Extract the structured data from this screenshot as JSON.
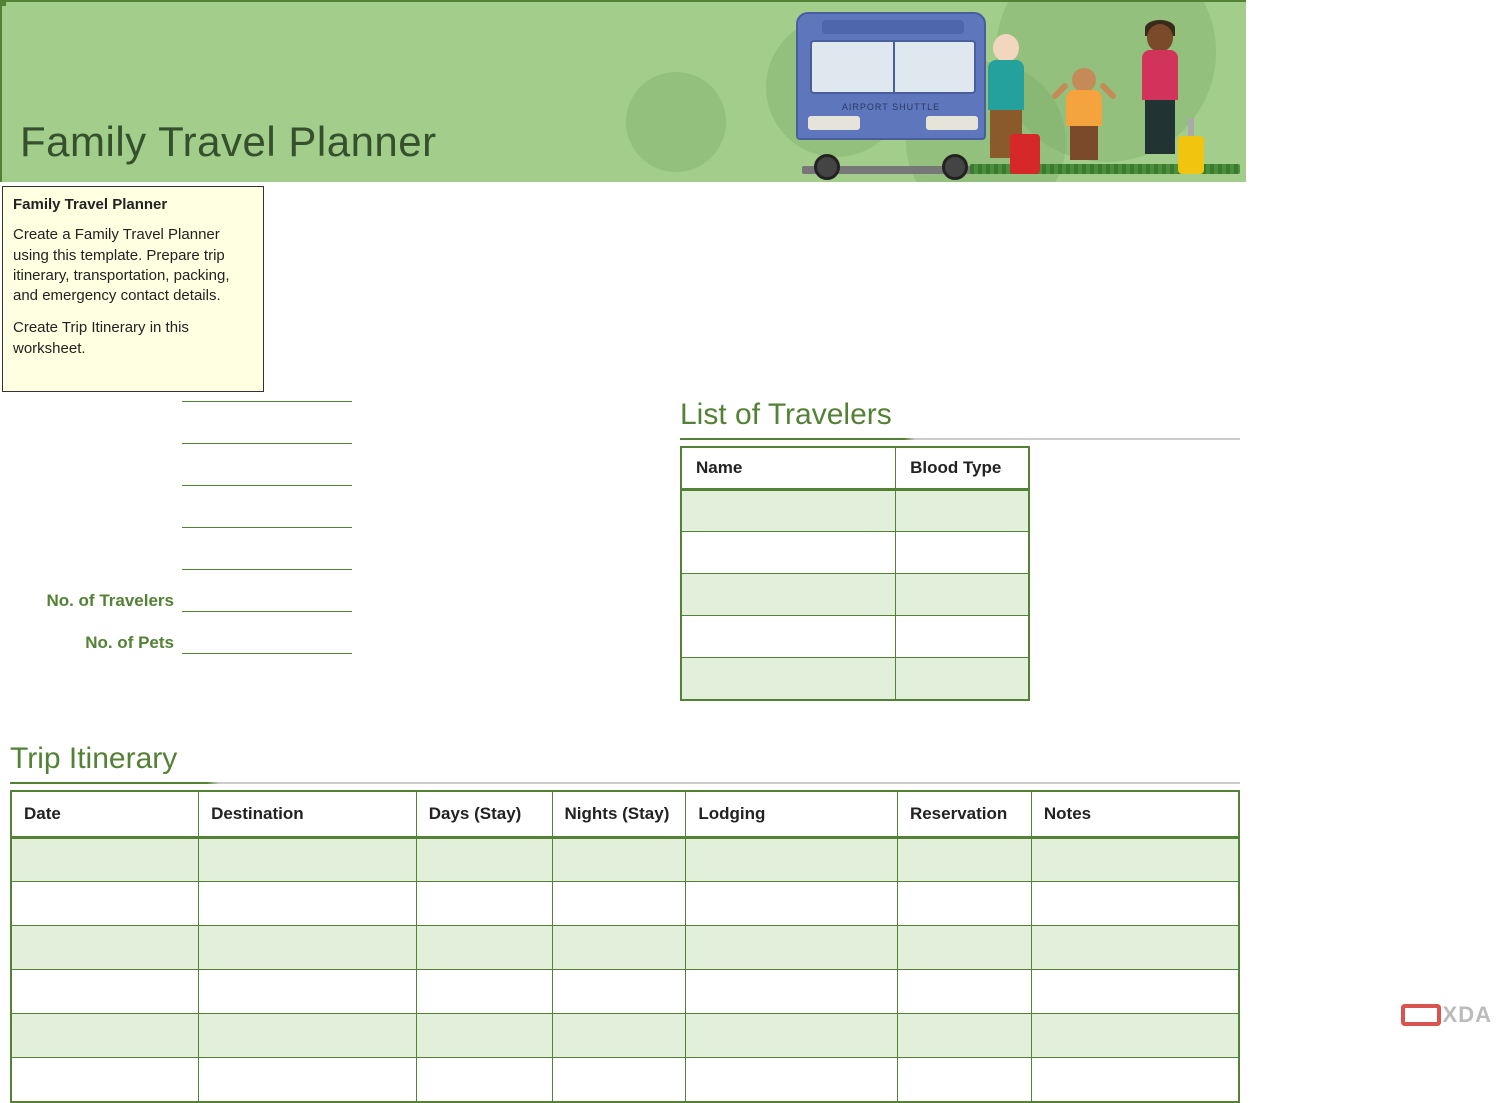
{
  "header": {
    "title": "Family Travel Planner",
    "bus_label": "AIRPORT SHUTTLE"
  },
  "tooltip": {
    "title": "Family Travel Planner",
    "para1": "Create a Family Travel Planner using this template. Prepare trip itinerary, transportation, packing, and emergency contact details.",
    "para2": "Create Trip Itinerary in this worksheet."
  },
  "form": {
    "labels": {
      "no_travelers": "No. of Travelers",
      "no_pets": "No. of Pets"
    }
  },
  "travelers_section": {
    "heading": "List of Travelers",
    "columns": {
      "name": "Name",
      "blood": "Blood Type"
    },
    "rows": [
      "",
      "",
      "",
      "",
      ""
    ]
  },
  "itinerary_section": {
    "heading": "Trip Itinerary",
    "columns": {
      "date": "Date",
      "destination": "Destination",
      "days": "Days (Stay)",
      "nights": "Nights (Stay)",
      "lodging": "Lodging",
      "reservation": "Reservation",
      "notes": "Notes"
    },
    "rows": [
      "",
      "",
      "",
      "",
      "",
      ""
    ]
  },
  "watermark": "XDA"
}
